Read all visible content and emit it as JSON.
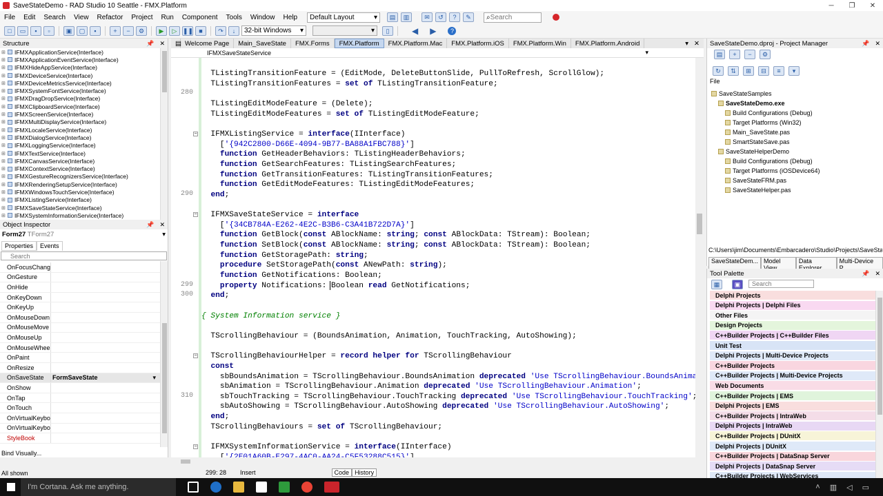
{
  "title_bar": {
    "title": "SaveStateDemo - RAD Studio 10 Seattle - FMX.Platform"
  },
  "menu": [
    "File",
    "Edit",
    "Search",
    "View",
    "Refactor",
    "Project",
    "Run",
    "Component",
    "Tools",
    "Window",
    "Help"
  ],
  "layout_combo": "Default Layout",
  "search_placeholder": "Search",
  "platform_combo": "32-bit Windows",
  "structure": {
    "title": "Structure",
    "items": [
      "IFMXApplicationService(Interface)",
      "IFMXApplicationEventService(Interface)",
      "IFMXHideAppService(Interface)",
      "IFMXDeviceService(Interface)",
      "IFMXDeviceMetricsService(Interface)",
      "IFMXSystemFontService(Interface)",
      "IFMXDragDropService(Interface)",
      "IFMXClipboardService(Interface)",
      "IFMXScreenService(Interface)",
      "IFMXMultiDisplayService(Interface)",
      "IFMXLocaleService(Interface)",
      "IFMXDialogService(Interface)",
      "IFMXLoggingService(Interface)",
      "IFMXTextService(Interface)",
      "IFMXCanvasService(Interface)",
      "IFMXContextService(Interface)",
      "IFMXGestureRecognizersService(Interface)",
      "IFMXRenderingSetupService(Interface)",
      "IFMXWindowsTouchService(Interface)",
      "IFMXListingService(Interface)",
      "IFMXSaveStateService(Interface)",
      "IFMXSystemInformationService(Interface)"
    ]
  },
  "object_inspector": {
    "title": "Object Inspector",
    "object": "Form27",
    "object_type": "TForm27",
    "tabs": [
      "Properties",
      "Events"
    ],
    "search_placeholder": "Search",
    "events": [
      {
        "name": "OnFocusChange",
        "value": ""
      },
      {
        "name": "OnGesture",
        "value": ""
      },
      {
        "name": "OnHide",
        "value": ""
      },
      {
        "name": "OnKeyDown",
        "value": ""
      },
      {
        "name": "OnKeyUp",
        "value": ""
      },
      {
        "name": "OnMouseDown",
        "value": ""
      },
      {
        "name": "OnMouseMove",
        "value": ""
      },
      {
        "name": "OnMouseUp",
        "value": ""
      },
      {
        "name": "OnMouseWheel",
        "value": ""
      },
      {
        "name": "OnPaint",
        "value": ""
      },
      {
        "name": "OnResize",
        "value": ""
      },
      {
        "name": "OnSaveState",
        "value": "FormSaveState"
      },
      {
        "name": "OnShow",
        "value": ""
      },
      {
        "name": "OnTap",
        "value": ""
      },
      {
        "name": "OnTouch",
        "value": ""
      },
      {
        "name": "OnVirtualKeyboa",
        "value": ""
      },
      {
        "name": "OnVirtualKeyboa",
        "value": ""
      },
      {
        "name": "StyleBook",
        "value": ""
      }
    ],
    "bind_visually": "Bind Visually...",
    "status": "All shown"
  },
  "editor": {
    "tabs": [
      "Welcome Page",
      "Main_SaveState",
      "FMX.Forms",
      "FMX.Platform",
      "FMX.Platform.Mac",
      "FMX.Platform.iOS",
      "FMX.Platform.Win",
      "FMX.Platform.Android"
    ],
    "active_tab": "FMX.Platform",
    "breadcrumb": "IFMXSaveStateService",
    "line_numbers": [
      {
        "n": "280",
        "row": 2
      },
      {
        "n": "290",
        "row": 12
      },
      {
        "n": "299",
        "row": 21
      },
      {
        "n": "300",
        "row": 22
      },
      {
        "n": "310",
        "row": 32
      }
    ],
    "lines": [
      [
        [
          "  TListingTransitionFeature = (EditMode, DeleteButtonSlide, PullToRefresh, ScrollGlow);",
          ""
        ]
      ],
      [
        [
          "  TListingTransitionFeatures = ",
          ""
        ],
        [
          "set of",
          "kw"
        ],
        [
          " TListingTransitionFeature;",
          ""
        ]
      ],
      [
        [
          "",
          ""
        ]
      ],
      [
        [
          "  TListingEditModeFeature = (Delete);",
          ""
        ]
      ],
      [
        [
          "  TListingEditModeFeatures = ",
          ""
        ],
        [
          "set of",
          "kw"
        ],
        [
          " TListingEditModeFeature;",
          ""
        ]
      ],
      [
        [
          "",
          ""
        ]
      ],
      [
        [
          "  IFMXListingService = ",
          ""
        ],
        [
          "interface",
          "kw"
        ],
        [
          "(IInterface)",
          ""
        ]
      ],
      [
        [
          "    [",
          ""
        ],
        [
          "'{942C2800-D66E-4094-9B77-BA88A1FBC788}'",
          "st"
        ],
        [
          "]",
          ""
        ]
      ],
      [
        [
          "    ",
          ""
        ],
        [
          "function",
          "kw"
        ],
        [
          " GetHeaderBehaviors: TListingHeaderBehaviors;",
          ""
        ]
      ],
      [
        [
          "    ",
          ""
        ],
        [
          "function",
          "kw"
        ],
        [
          " GetSearchFeatures: TListingSearchFeatures;",
          ""
        ]
      ],
      [
        [
          "    ",
          ""
        ],
        [
          "function",
          "kw"
        ],
        [
          " GetTransitionFeatures: TListingTransitionFeatures;",
          ""
        ]
      ],
      [
        [
          "    ",
          ""
        ],
        [
          "function",
          "kw"
        ],
        [
          " GetEditModeFeatures: TListingEditModeFeatures;",
          ""
        ]
      ],
      [
        [
          "  ",
          ""
        ],
        [
          "end",
          "kw"
        ],
        [
          ";",
          ""
        ]
      ],
      [
        [
          "",
          ""
        ]
      ],
      [
        [
          "  IFMXSaveStateService = ",
          ""
        ],
        [
          "interface",
          "kw"
        ]
      ],
      [
        [
          "    [",
          ""
        ],
        [
          "'{34CB784A-E262-4E2C-B3B6-C3A41B722D7A}'",
          "st"
        ],
        [
          "]",
          ""
        ]
      ],
      [
        [
          "    ",
          ""
        ],
        [
          "function",
          "kw"
        ],
        [
          " GetBlock(",
          ""
        ],
        [
          "const",
          "kw"
        ],
        [
          " ABlockName: ",
          ""
        ],
        [
          "string",
          "kw"
        ],
        [
          "; ",
          ""
        ],
        [
          "const",
          "kw"
        ],
        [
          " ABlockData: TStream): Boolean;",
          ""
        ]
      ],
      [
        [
          "    ",
          ""
        ],
        [
          "function",
          "kw"
        ],
        [
          " SetBlock(",
          ""
        ],
        [
          "const",
          "kw"
        ],
        [
          " ABlockName: ",
          ""
        ],
        [
          "string",
          "kw"
        ],
        [
          "; ",
          ""
        ],
        [
          "const",
          "kw"
        ],
        [
          " ABlockData: TStream): Boolean;",
          ""
        ]
      ],
      [
        [
          "    ",
          ""
        ],
        [
          "function",
          "kw"
        ],
        [
          " GetStoragePath: ",
          ""
        ],
        [
          "string",
          "kw"
        ],
        [
          ";",
          ""
        ]
      ],
      [
        [
          "    ",
          ""
        ],
        [
          "procedure",
          "kw"
        ],
        [
          " SetStoragePath(",
          ""
        ],
        [
          "const",
          "kw"
        ],
        [
          " ANewPath: ",
          ""
        ],
        [
          "string",
          "kw"
        ],
        [
          ");",
          ""
        ]
      ],
      [
        [
          "    ",
          ""
        ],
        [
          "function",
          "kw"
        ],
        [
          " GetNotifications: Boolean;",
          ""
        ]
      ],
      [
        [
          "    ",
          ""
        ],
        [
          "property",
          "kw"
        ],
        [
          " Notifications: Boolean ",
          ""
        ],
        [
          "read",
          "kw"
        ],
        [
          " GetNotifications;",
          ""
        ]
      ],
      [
        [
          "  ",
          ""
        ],
        [
          "end",
          "kw"
        ],
        [
          ";",
          ""
        ]
      ],
      [
        [
          "",
          ""
        ]
      ],
      [
        [
          "{ System Information service }",
          "cm"
        ]
      ],
      [
        [
          "",
          ""
        ]
      ],
      [
        [
          "  TScrollingBehaviour = (BoundsAnimation, Animation, TouchTracking, AutoShowing);",
          ""
        ]
      ],
      [
        [
          "",
          ""
        ]
      ],
      [
        [
          "  TScrollingBehaviourHelper = ",
          ""
        ],
        [
          "record helper for",
          "kw"
        ],
        [
          " TScrollingBehaviour",
          ""
        ]
      ],
      [
        [
          "  ",
          ""
        ],
        [
          "const",
          "kw"
        ]
      ],
      [
        [
          "    sbBoundsAnimation = TScrollingBehaviour.BoundsAnimation ",
          ""
        ],
        [
          "deprecated",
          "kw"
        ],
        [
          " ",
          ""
        ],
        [
          "'Use TScrollingBehaviour.BoundsAnima",
          "st"
        ]
      ],
      [
        [
          "    sbAnimation = TScrollingBehaviour.Animation ",
          ""
        ],
        [
          "deprecated",
          "kw"
        ],
        [
          " ",
          ""
        ],
        [
          "'Use TScrollingBehaviour.Animation'",
          "st"
        ],
        [
          ";",
          ""
        ]
      ],
      [
        [
          "    sbTouchTracking = TScrollingBehaviour.TouchTracking ",
          ""
        ],
        [
          "deprecated",
          "kw"
        ],
        [
          " ",
          ""
        ],
        [
          "'Use TScrollingBehaviour.TouchTracking'",
          "st"
        ],
        [
          ";",
          ""
        ]
      ],
      [
        [
          "    sbAutoShowing = TScrollingBehaviour.AutoShowing ",
          ""
        ],
        [
          "deprecated",
          "kw"
        ],
        [
          " ",
          ""
        ],
        [
          "'Use TScrollingBehaviour.AutoShowing'",
          "st"
        ],
        [
          ";",
          ""
        ]
      ],
      [
        [
          "  ",
          ""
        ],
        [
          "end",
          "kw"
        ],
        [
          ";",
          ""
        ]
      ],
      [
        [
          "  TScrollingBehaviours = ",
          ""
        ],
        [
          "set of",
          "kw"
        ],
        [
          " TScrollingBehaviour;",
          ""
        ]
      ],
      [
        [
          "",
          ""
        ]
      ],
      [
        [
          "  IFMXSystemInformationService = ",
          ""
        ],
        [
          "interface",
          "kw"
        ],
        [
          "(IInterface)",
          ""
        ]
      ],
      [
        [
          "    [",
          ""
        ],
        [
          "'{2E01A60B-E297-4AC0-AA24-C5F53288C515}'",
          "st"
        ],
        [
          "]",
          ""
        ]
      ]
    ],
    "status": {
      "position": "299: 28",
      "mode": "Insert",
      "tabs": [
        "Code",
        "History"
      ]
    }
  },
  "project_manager": {
    "title": "SaveStateDemo.dproj - Project Manager",
    "file_label": "File",
    "items": [
      {
        "label": "SaveStateSamples",
        "bold": false
      },
      {
        "label": "SaveStateDemo.exe",
        "bold": true
      },
      {
        "label": "Build Configurations (Debug)",
        "bold": false
      },
      {
        "label": "Target Platforms (Win32)",
        "bold": false
      },
      {
        "label": "Main_SaveState.pas",
        "bold": false
      },
      {
        "label": "SmartStateSave.pas",
        "bold": false
      },
      {
        "label": "SaveStateHelperDemo",
        "bold": false
      },
      {
        "label": "Build Configurations (Debug)",
        "bold": false
      },
      {
        "label": "Target Platforms (iOSDevice64)",
        "bold": false
      },
      {
        "label": "SaveStateFRM.pas",
        "bold": false
      },
      {
        "label": "SaveStateHelper.pas",
        "bold": false
      }
    ],
    "path": "C:\\Users\\jim\\Documents\\Embarcadero\\Studio\\Projects\\SaveState\\",
    "tabs": [
      "SaveStateDem...",
      "Model View",
      "Data Explorer",
      "Multi-Device P..."
    ]
  },
  "tool_palette": {
    "title": "Tool Palette",
    "search_placeholder": "Search",
    "categories": [
      {
        "label": "Delphi Projects",
        "color": "#f9dede"
      },
      {
        "label": "Delphi Projects | Delphi Files",
        "color": "#f9d9f1"
      },
      {
        "label": "Other Files",
        "color": "#f4f4f4"
      },
      {
        "label": "Design Projects",
        "color": "#e4f5dc"
      },
      {
        "label": "C++Builder Projects | C++Builder Files",
        "color": "#f0d6f4"
      },
      {
        "label": "Unit Test",
        "color": "#d8e4f6"
      },
      {
        "label": "Delphi Projects | Multi-Device Projects",
        "color": "#dfe9f8"
      },
      {
        "label": "C++Builder Projects",
        "color": "#f9d6e0"
      },
      {
        "label": "C++Builder Projects | Multi-Device Projects",
        "color": "#dfe9f8"
      },
      {
        "label": "Web Documents",
        "color": "#f9dce6"
      },
      {
        "label": "C++Builder Projects | EMS",
        "color": "#e0f4dc"
      },
      {
        "label": "Delphi Projects | EMS",
        "color": "#f9dede"
      },
      {
        "label": "C++Builder Projects | IntraWeb",
        "color": "#f4dde8"
      },
      {
        "label": "Delphi Projects | IntraWeb",
        "color": "#e8d8f4"
      },
      {
        "label": "C++Builder Projects | DUnitX",
        "color": "#f7f4d8"
      },
      {
        "label": "Delphi Projects | DUnitX",
        "color": "#dfe9f8"
      },
      {
        "label": "C++Builder Projects | DataSnap Server",
        "color": "#f9d6dc"
      },
      {
        "label": "Delphi Projects | DataSnap Server",
        "color": "#e6dcf6"
      },
      {
        "label": "C++Builder Projects | WebServices",
        "color": "#dfe9f8"
      }
    ]
  },
  "taskbar": {
    "cortana": "I'm Cortana. Ask me anything."
  }
}
